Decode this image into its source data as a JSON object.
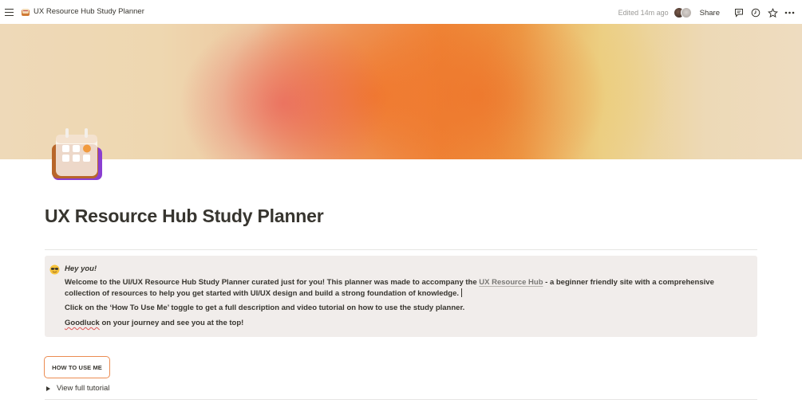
{
  "topbar": {
    "breadcrumb_title": "UX Resource Hub Study Planner",
    "edited": "Edited 14m ago",
    "share_label": "Share",
    "icons": [
      "menu-icon",
      "comment-icon",
      "clock-icon",
      "star-icon",
      "more-icon"
    ]
  },
  "page": {
    "title": "UX Resource Hub Study Planner",
    "icon": "calendar-icon"
  },
  "callout": {
    "emoji": "sunglasses-emoji",
    "heading": "Hey you!",
    "p1_before": "Welcome to the UI/UX Resource Hub Study Planner curated just for you! This planner was made to accompany the ",
    "p1_link": "UX Resource Hub",
    "p1_after": "  - a beginner friendly site with a comprehensive collection of resources to help you get started with UI/UX design and build a strong foundation of knowledge.",
    "p2": "Click on the ‘How To Use Me’ toggle to get a full description and video tutorial on how to use the study planner.",
    "p3_squiggle": "Goodluck",
    "p3_rest": " on your journey and see you at the top!"
  },
  "how_to_button": "HOW TO USE ME",
  "toggle_label": "View full tutorial",
  "colors": {
    "accent_orange": "#eb8c52",
    "callout_bg": "#f1edeb",
    "text": "#37352f"
  }
}
